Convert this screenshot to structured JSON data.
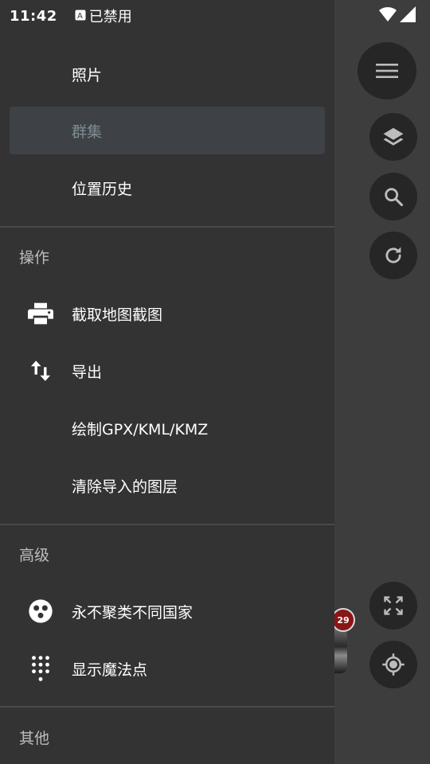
{
  "status_bar": {
    "time": "11:42",
    "notification_text": "已禁用"
  },
  "drawer": {
    "items_top": [
      {
        "label": "照片"
      },
      {
        "label": "群集",
        "selected": true
      },
      {
        "label": "位置历史"
      }
    ],
    "sections": [
      {
        "title": "操作",
        "items": [
          {
            "label": "截取地图截图",
            "icon": "printer-icon"
          },
          {
            "label": "导出",
            "icon": "swap-vertical-icon"
          },
          {
            "label": "绘制GPX/KML/KMZ"
          },
          {
            "label": "清除导入的图层"
          }
        ]
      },
      {
        "title": "高级",
        "items": [
          {
            "label": "永不聚类不同国家",
            "icon": "cluster-dots-icon"
          },
          {
            "label": "显示魔法点",
            "icon": "dot-grid-icon"
          }
        ]
      },
      {
        "title": "其他",
        "items": []
      }
    ]
  },
  "map": {
    "cluster_badge_count": "29",
    "fab_buttons": [
      "menu-icon",
      "layers-icon",
      "search-icon",
      "refresh-icon",
      "fullscreen-icon",
      "my-location-icon"
    ]
  }
}
